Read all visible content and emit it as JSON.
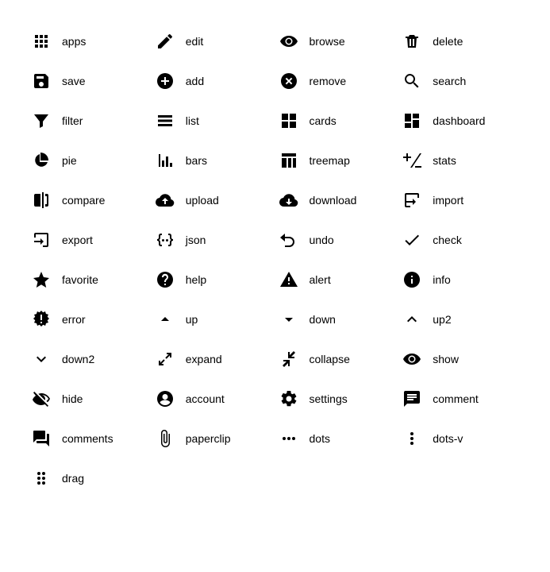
{
  "icons": [
    {
      "id": "apps",
      "label": "apps"
    },
    {
      "id": "edit",
      "label": "edit"
    },
    {
      "id": "browse",
      "label": "browse"
    },
    {
      "id": "delete",
      "label": "delete"
    },
    {
      "id": "save",
      "label": "save"
    },
    {
      "id": "add",
      "label": "add"
    },
    {
      "id": "remove",
      "label": "remove"
    },
    {
      "id": "search",
      "label": "search"
    },
    {
      "id": "filter",
      "label": "filter"
    },
    {
      "id": "list",
      "label": "list"
    },
    {
      "id": "cards",
      "label": "cards"
    },
    {
      "id": "dashboard",
      "label": "dashboard"
    },
    {
      "id": "pie",
      "label": "pie"
    },
    {
      "id": "bars",
      "label": "bars"
    },
    {
      "id": "treemap",
      "label": "treemap"
    },
    {
      "id": "stats",
      "label": "stats"
    },
    {
      "id": "compare",
      "label": "compare"
    },
    {
      "id": "upload",
      "label": "upload"
    },
    {
      "id": "download",
      "label": "download"
    },
    {
      "id": "import",
      "label": "import"
    },
    {
      "id": "export",
      "label": "export"
    },
    {
      "id": "json",
      "label": "json"
    },
    {
      "id": "undo",
      "label": "undo"
    },
    {
      "id": "check",
      "label": "check"
    },
    {
      "id": "favorite",
      "label": "favorite"
    },
    {
      "id": "help",
      "label": "help"
    },
    {
      "id": "alert",
      "label": "alert"
    },
    {
      "id": "info",
      "label": "info"
    },
    {
      "id": "error",
      "label": "error"
    },
    {
      "id": "up",
      "label": "up"
    },
    {
      "id": "down",
      "label": "down"
    },
    {
      "id": "up2",
      "label": "up2"
    },
    {
      "id": "down2",
      "label": "down2"
    },
    {
      "id": "expand",
      "label": "expand"
    },
    {
      "id": "collapse",
      "label": "collapse"
    },
    {
      "id": "show",
      "label": "show"
    },
    {
      "id": "hide",
      "label": "hide"
    },
    {
      "id": "account",
      "label": "account"
    },
    {
      "id": "settings",
      "label": "settings"
    },
    {
      "id": "comment",
      "label": "comment"
    },
    {
      "id": "comments",
      "label": "comments"
    },
    {
      "id": "paperclip",
      "label": "paperclip"
    },
    {
      "id": "dots",
      "label": "dots"
    },
    {
      "id": "dots-v",
      "label": "dots-v"
    },
    {
      "id": "drag",
      "label": "drag"
    }
  ]
}
